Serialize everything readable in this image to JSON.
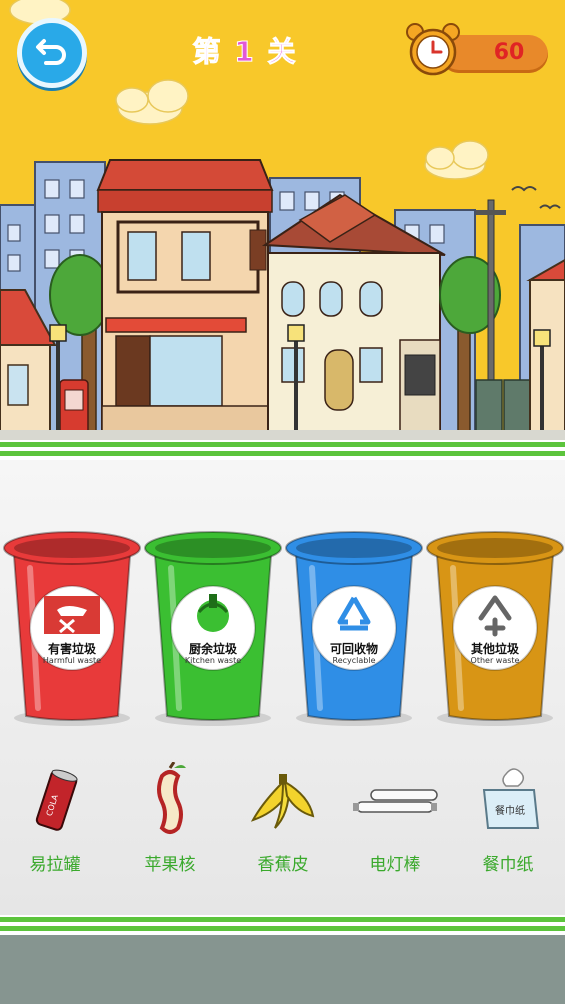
{
  "header": {
    "level_title": "第 1 关",
    "timer_value": "60"
  },
  "bins": [
    {
      "label": "有害垃圾",
      "sublabel": "Harmful waste",
      "color": "#e83a3a",
      "icon": "hazard-bottle-icon"
    },
    {
      "label": "厨余垃圾",
      "sublabel": "Kitchen waste",
      "color": "#3bbf32",
      "icon": "food-scraps-icon"
    },
    {
      "label": "可回收物",
      "sublabel": "Recyclable",
      "color": "#2f8ee6",
      "icon": "recycle-icon"
    },
    {
      "label": "其他垃圾",
      "sublabel": "Other waste",
      "color": "#d89515",
      "icon": "other-waste-icon"
    }
  ],
  "items": [
    {
      "label": "易拉罐",
      "icon": "cola-can-icon"
    },
    {
      "label": "苹果核",
      "icon": "apple-core-icon"
    },
    {
      "label": "香蕉皮",
      "icon": "banana-peel-icon"
    },
    {
      "label": "电灯棒",
      "icon": "fluorescent-tube-icon"
    },
    {
      "label": "餐巾纸",
      "icon": "tissue-box-icon"
    }
  ],
  "colors": {
    "sky": "#f8c82a",
    "stripe_green": "#5cc43c",
    "label_green": "#3aa92c",
    "title_pink": "#e357d6",
    "timer_red": "#e02424"
  }
}
